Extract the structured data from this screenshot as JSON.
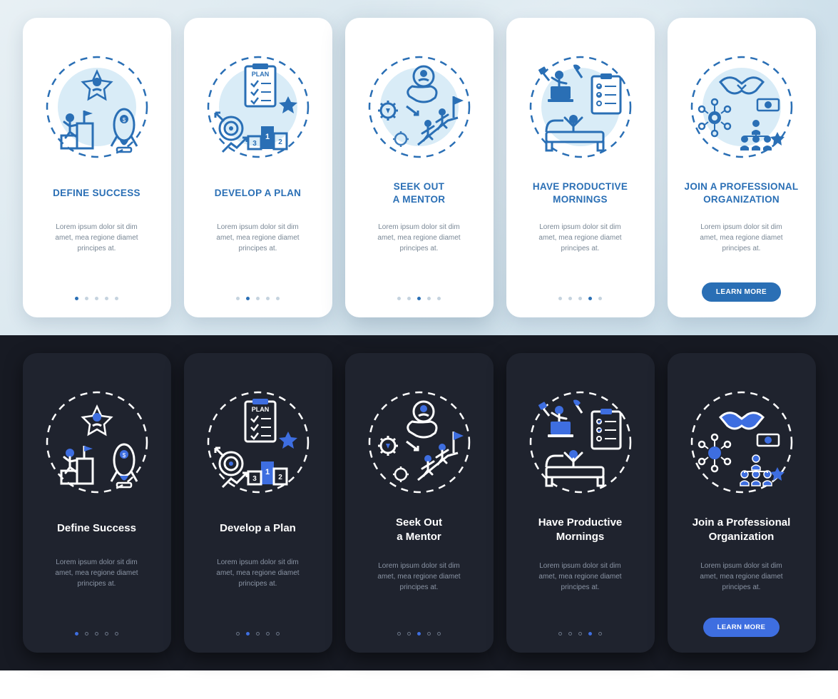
{
  "body_text": "Lorem ipsum dolor sit dim\namet, mea regione diamet\nprincipes at.",
  "cta_label": "LEARN MORE",
  "light": {
    "cards": [
      {
        "title": "DEFINE SUCCESS",
        "active_dot": 0
      },
      {
        "title": "DEVELOP A PLAN",
        "active_dot": 1
      },
      {
        "title": "SEEK OUT\nA MENTOR",
        "active_dot": 2,
        "highlight": true
      },
      {
        "title": "HAVE PRODUCTIVE\nMORNINGS",
        "active_dot": 3
      },
      {
        "title": "JOIN A PROFESSIONAL\nORGANIZATION",
        "active_dot": 4,
        "cta": true
      }
    ]
  },
  "dark": {
    "cards": [
      {
        "title": "Define Success",
        "active_dot": 0
      },
      {
        "title": "Develop a Plan",
        "active_dot": 1
      },
      {
        "title": "Seek Out\na Mentor",
        "active_dot": 2
      },
      {
        "title": "Have Productive\nMornings",
        "active_dot": 3
      },
      {
        "title": "Join a Professional\nOrganization",
        "active_dot": 4,
        "cta": true
      }
    ]
  },
  "colors": {
    "light_accent": "#2a6fb5",
    "dark_accent": "#3e6ee0",
    "dark_bg": "#171a23",
    "card_dark_bg": "#1f232e"
  }
}
